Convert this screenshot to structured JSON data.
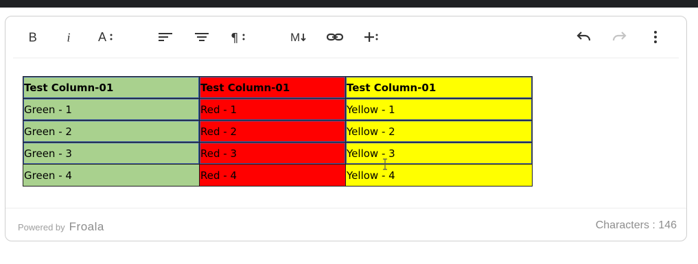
{
  "toolbar": {
    "buttons": [
      {
        "id": "bold",
        "icon": "bold-icon"
      },
      {
        "id": "italic",
        "icon": "italic-icon"
      },
      {
        "id": "text-format",
        "icon": "text-format-more-icon"
      },
      {
        "id": "align-left",
        "icon": "align-left-icon"
      },
      {
        "id": "align-center",
        "icon": "align-center-icon"
      },
      {
        "id": "paragraph",
        "icon": "paragraph-more-icon"
      },
      {
        "id": "markdown",
        "icon": "markdown-icon"
      },
      {
        "id": "link",
        "icon": "link-icon"
      },
      {
        "id": "insert-more",
        "icon": "insert-more-icon"
      },
      {
        "id": "undo",
        "icon": "undo-icon"
      },
      {
        "id": "redo",
        "icon": "redo-icon",
        "disabled": true
      },
      {
        "id": "more",
        "icon": "more-vertical-icon"
      }
    ]
  },
  "table": {
    "header": [
      "Test Column-01",
      "Test Column-01",
      "Test Column-01"
    ],
    "rows": [
      [
        "Green - 1",
        "Red - 1",
        "Yellow - 1"
      ],
      [
        "Green - 2",
        "Red - 2",
        "Yellow - 2"
      ],
      [
        "Green - 3",
        "Red - 3",
        "Yellow - 3"
      ],
      [
        "Green - 4",
        "Red - 4",
        "Yellow - 4"
      ]
    ],
    "column_colors": [
      "#a9d18e",
      "#ff0000",
      "#ffff00"
    ]
  },
  "footer": {
    "powered_by": "Powered by",
    "brand": "Froala",
    "characters": "Characters : 146"
  }
}
